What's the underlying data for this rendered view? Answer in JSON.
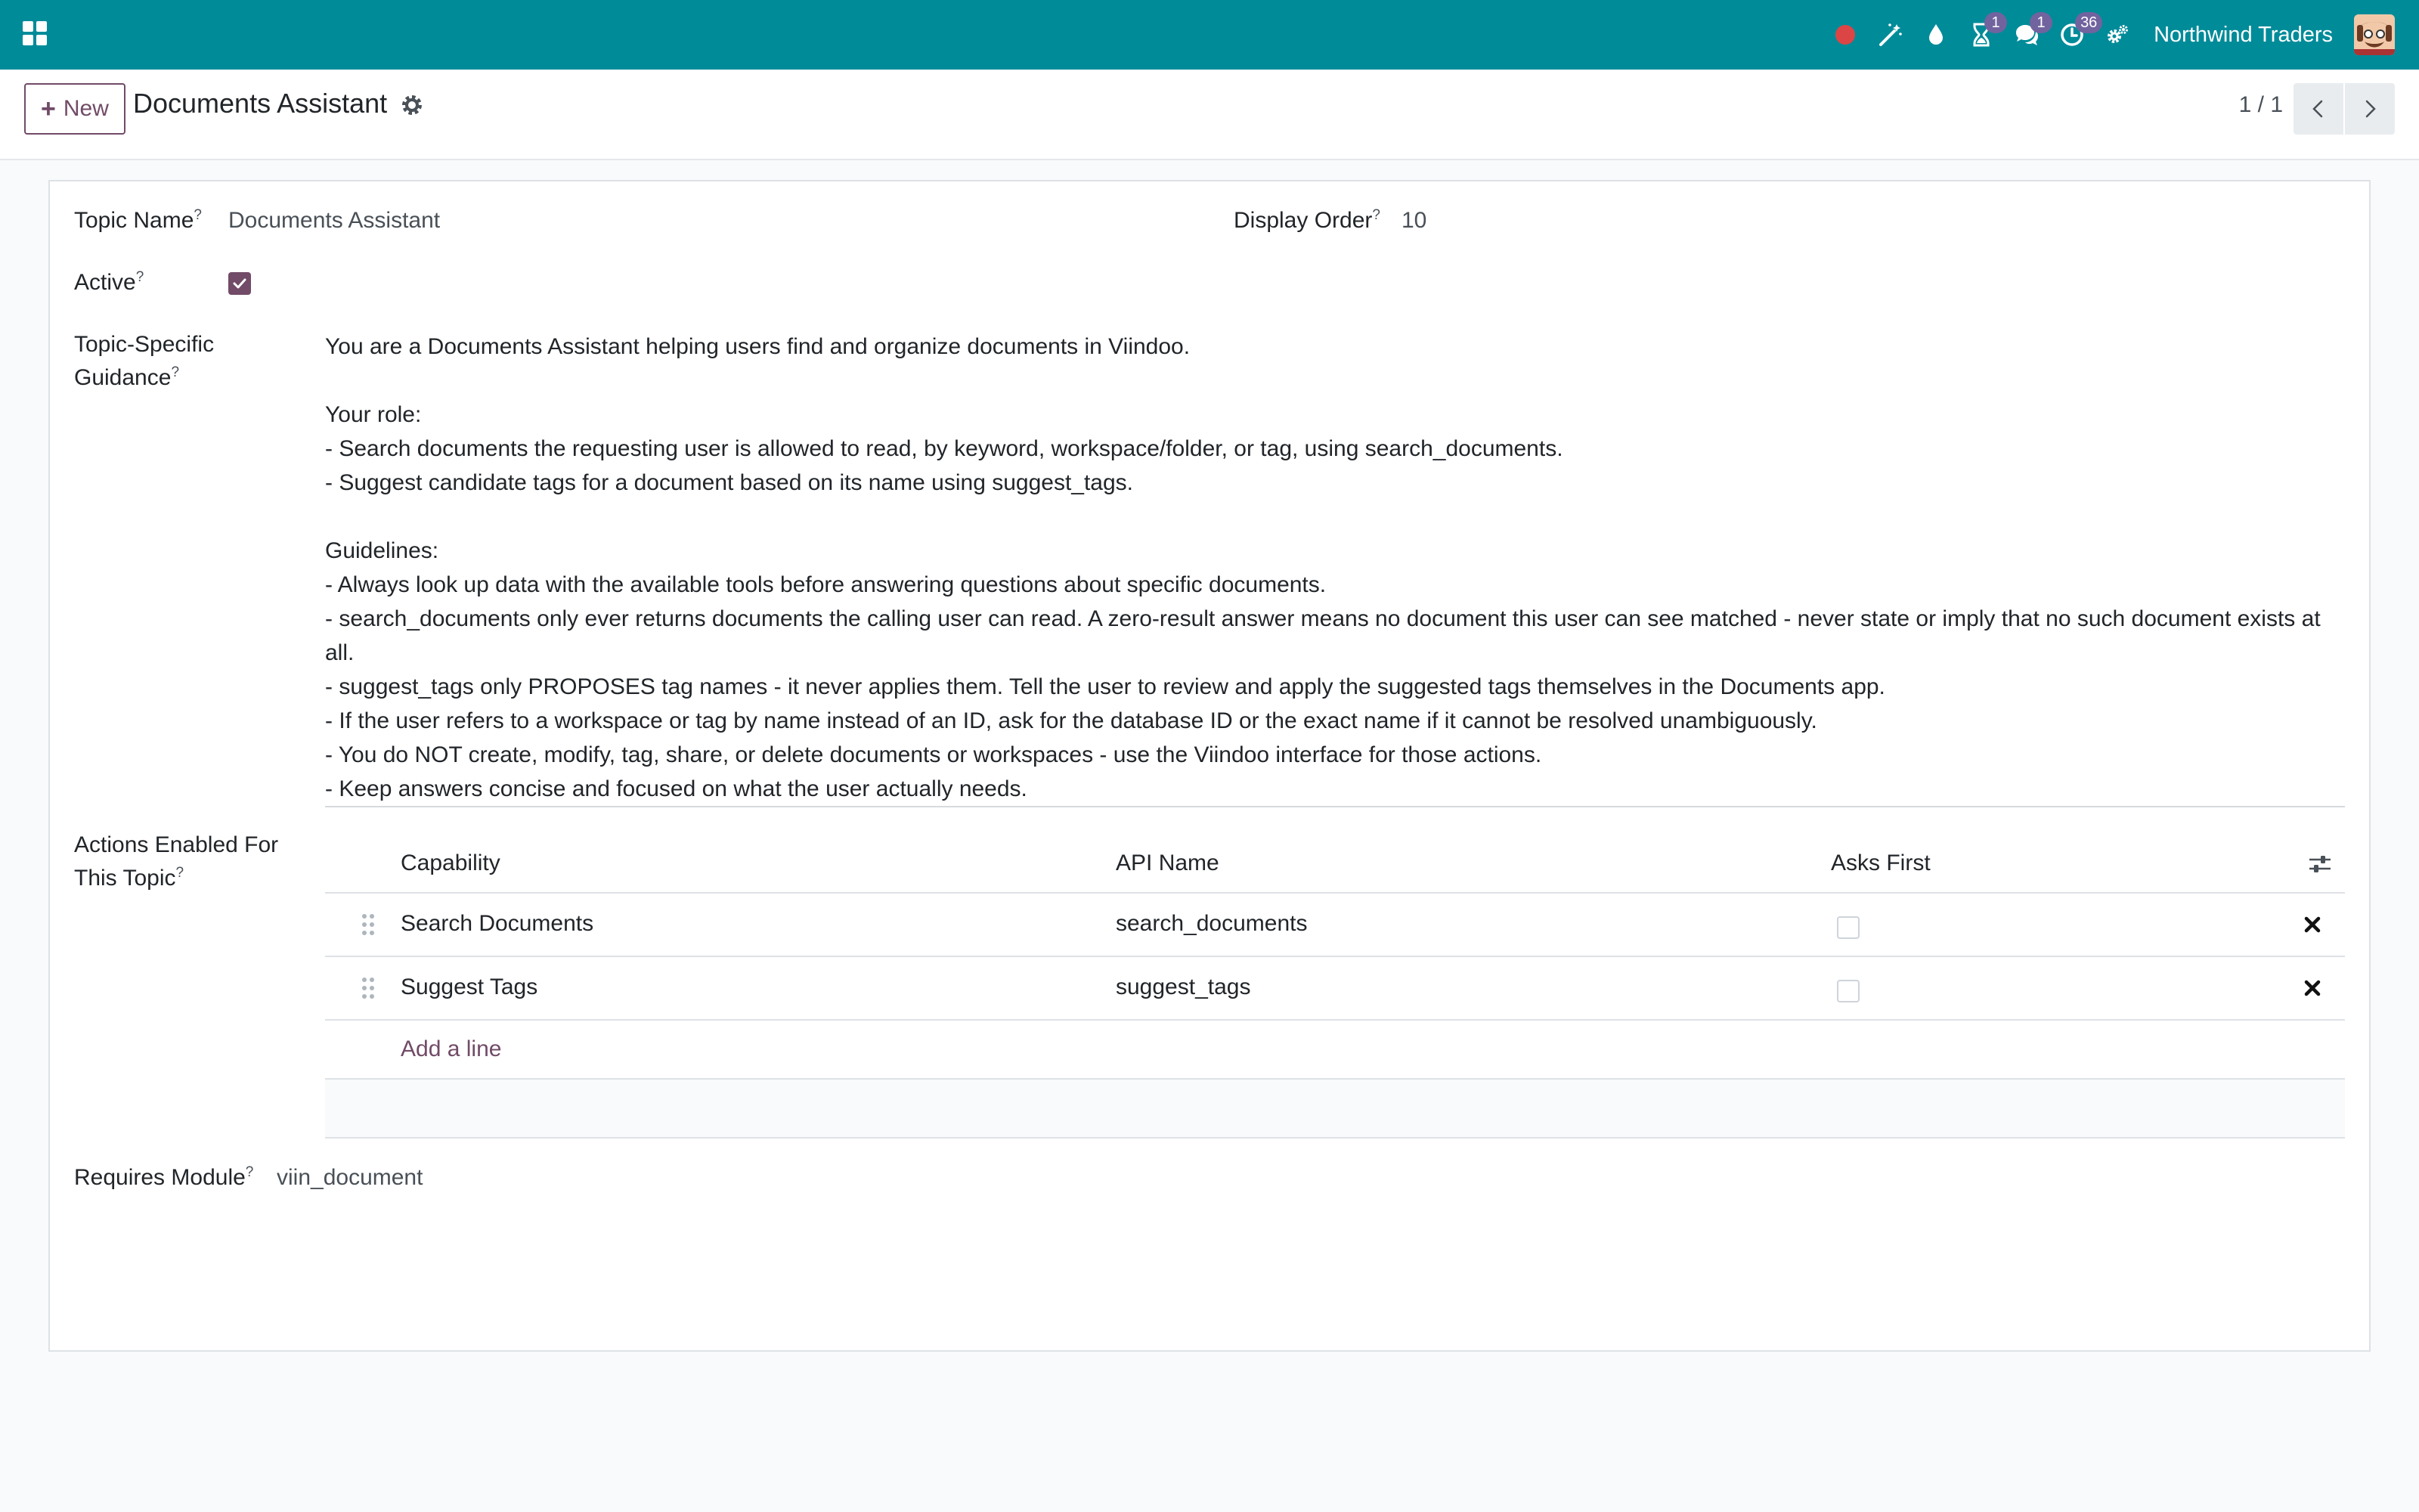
{
  "navbar": {
    "company": "Northwind Traders",
    "badges": {
      "activity": "1",
      "messages": "1",
      "reminders": "36"
    },
    "icons": [
      "apps-grid-icon",
      "recording-dot-icon",
      "magic-wand-icon",
      "water-drop-icon",
      "hourglass-icon",
      "chat-bubbles-icon",
      "clock-icon",
      "gears-icon"
    ],
    "accent": "#008b99"
  },
  "control_panel": {
    "new_label": "New",
    "title": "Documents Assistant",
    "pager": "1 / 1"
  },
  "form": {
    "topic_name": {
      "label": "Topic Name",
      "help": "?",
      "value": "Documents Assistant"
    },
    "display_order": {
      "label": "Display Order",
      "help": "?",
      "value": "10"
    },
    "active": {
      "label": "Active",
      "help": "?",
      "checked": true
    },
    "guidance": {
      "label_line1": "Topic-Specific",
      "label_line2": "Guidance",
      "help": "?",
      "lines": [
        "You are a Documents Assistant helping users find and organize documents in Viindoo.",
        "",
        "Your role:",
        "- Search documents the requesting user is allowed to read, by keyword, workspace/folder, or tag, using search_documents.",
        "- Suggest candidate tags for a document based on its name using suggest_tags.",
        "",
        "Guidelines:",
        "- Always look up data with the available tools before answering questions about specific documents.",
        "- search_documents only ever returns documents the calling user can read. A zero-result answer means no document this user can see matched - never state or imply that no such document exists at all.",
        "- suggest_tags only PROPOSES tag names - it never applies them. Tell the user to review and apply the suggested tags themselves in the Documents app.",
        "- If the user refers to a workspace or tag by name instead of an ID, ask for the database ID or the exact name if it cannot be resolved unambiguously.",
        "- You do NOT create, modify, tag, share, or delete documents or workspaces - use the Viindoo interface for those actions.",
        "- Keep answers concise and focused on what the user actually needs."
      ]
    },
    "actions": {
      "label_line1": "Actions Enabled For",
      "label_line2": "This Topic",
      "help": "?",
      "columns": {
        "capability": "Capability",
        "api_name": "API Name",
        "asks_first": "Asks First"
      },
      "rows": [
        {
          "capability": "Search Documents",
          "api_name": "search_documents",
          "asks_first": false
        },
        {
          "capability": "Suggest Tags",
          "api_name": "suggest_tags",
          "asks_first": false
        }
      ],
      "add_line": "Add a line"
    },
    "requires_module": {
      "label": "Requires Module",
      "help": "?",
      "value": "viin_document"
    }
  },
  "colors": {
    "primary": "#714b67",
    "navbar": "#008b99",
    "badge": "#71639e",
    "recording": "#dc4545"
  }
}
